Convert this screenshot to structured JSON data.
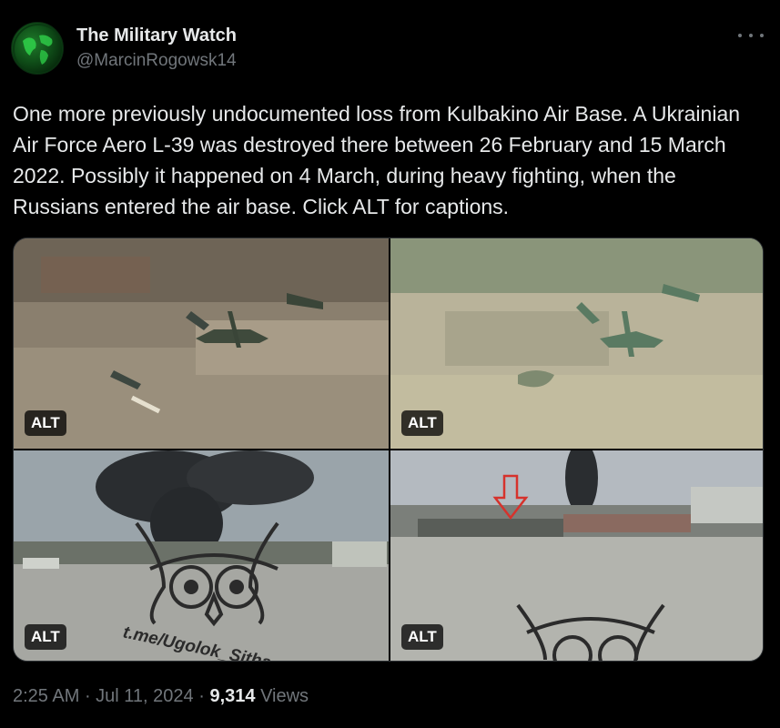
{
  "account": {
    "name": "The Military Watch",
    "handle": "@MarcinRogowsk14",
    "avatar_icon": "globe-map-avatar",
    "more_icon": "more-dots-icon"
  },
  "tweet": {
    "text": "One more previously undocumented loss from Kulbakino Air Base. A Ukrainian Air Force Aero L-39 was destroyed there between 26 February and 15 March 2022. Possibly it happened on 4 March, during heavy fighting, when the Russians entered the air base. Click ALT for captions."
  },
  "media": [
    {
      "alt_label": "ALT"
    },
    {
      "alt_label": "ALT"
    },
    {
      "alt_label": "ALT",
      "watermark": "t.me/Ugolok_Sitha"
    },
    {
      "alt_label": "ALT"
    }
  ],
  "meta": {
    "time": "2:25 AM",
    "sep1": " · ",
    "date": "Jul 11, 2024",
    "sep2": " · ",
    "views_count": "9,314",
    "views_label": " Views"
  },
  "colors": {
    "background": "#000000",
    "text": "#e7e9ea",
    "muted": "#71767b",
    "arrow_red": "#d6322c"
  }
}
